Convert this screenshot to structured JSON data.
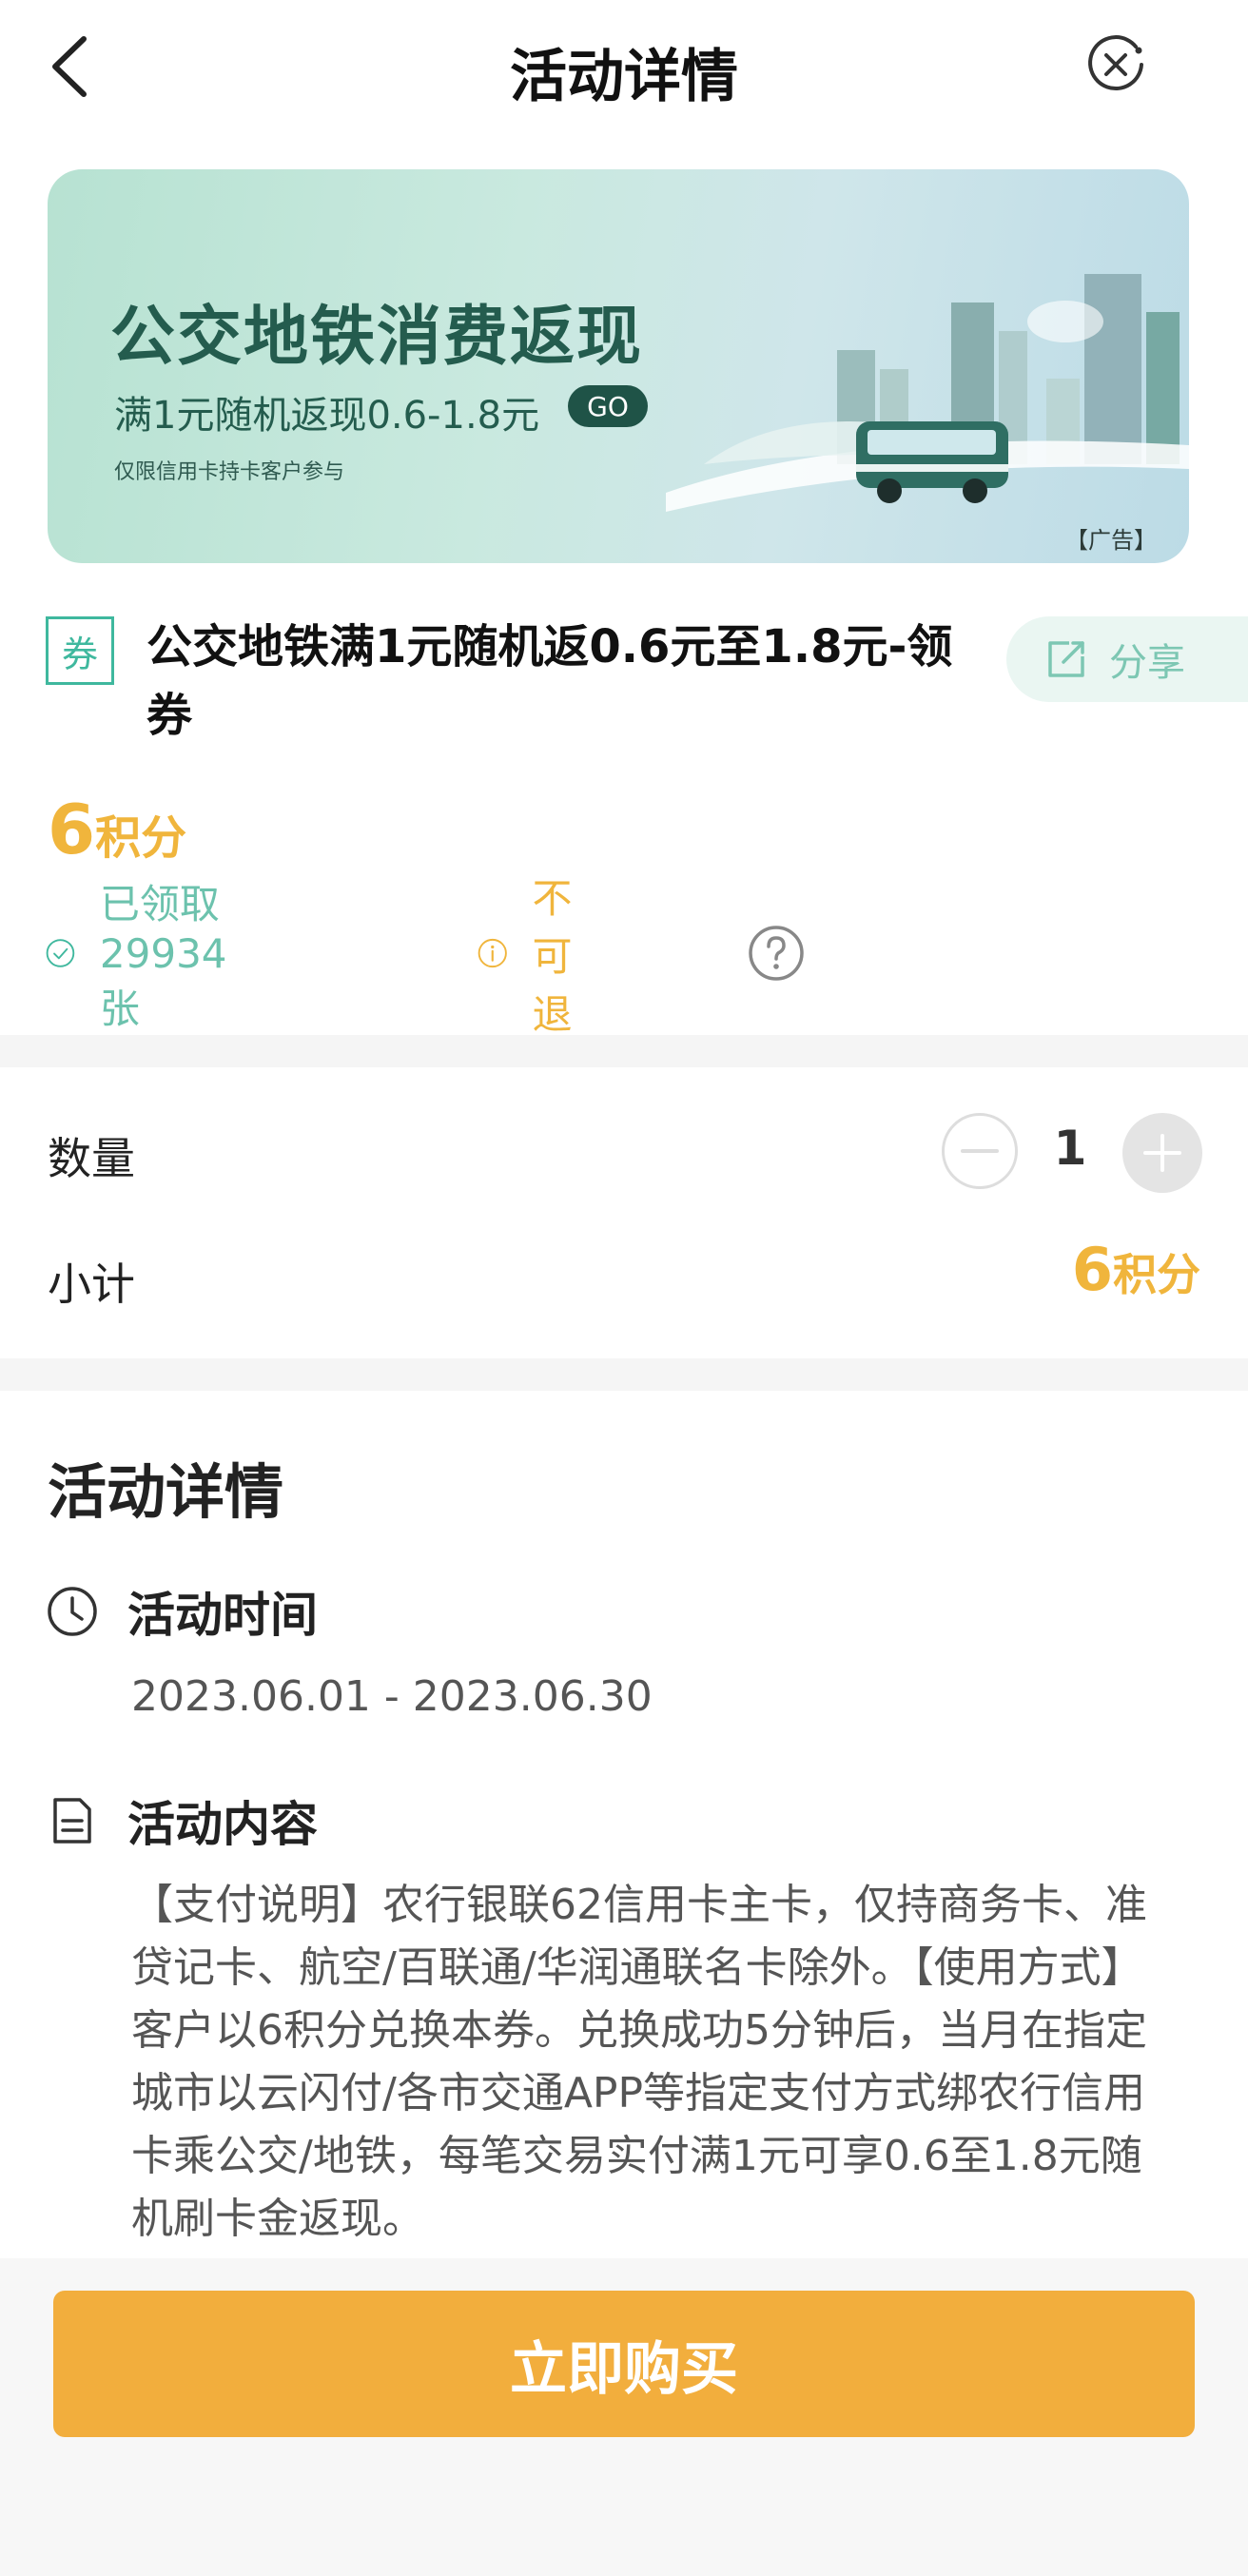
{
  "header": {
    "title": "活动详情",
    "back_icon": "chevron-left-icon",
    "close_icon": "close-circle-icon"
  },
  "banner": {
    "title": "公交地铁消费返现",
    "subtitle": "满1元随机返现0.6-1.8元",
    "go_label": "GO",
    "note": "仅限信用卡持卡客户参与",
    "ad_label": "【广告】"
  },
  "coupon": {
    "tag": "券",
    "title": "公交地铁满1元随机返0.6元至1.8元-领券",
    "share_label": "分享",
    "points_value": "6",
    "points_unit": "积分",
    "claimed_text": "已领取29934张",
    "refund_text": "不可退"
  },
  "quantity": {
    "label": "数量",
    "value": "1",
    "subtotal_label": "小计",
    "subtotal_value": "6",
    "subtotal_unit": "积分"
  },
  "details": {
    "heading": "活动详情",
    "time_heading": "活动时间",
    "date_range": "2023.06.01 - 2023.06.30",
    "content_heading": "活动内容",
    "content_text": "【支付说明】农行银联62信用卡主卡，仅持商务卡、准贷记卡、航空/百联通/华润通联名卡除外。【使用方式】客户以6积分兑换本券。兑换成功5分钟后，当月在指定城市以云闪付/各市交通APP等指定支付方式绑农行信用卡乘公交/地铁，每笔交易实付满1元可享0.6至1.8元随机刷卡金返现。"
  },
  "footer": {
    "buy_label": "立即购买"
  },
  "colors": {
    "accent_orange": "#f2ae3d",
    "points_gold": "#f0b53c",
    "green": "#3fb89e"
  }
}
